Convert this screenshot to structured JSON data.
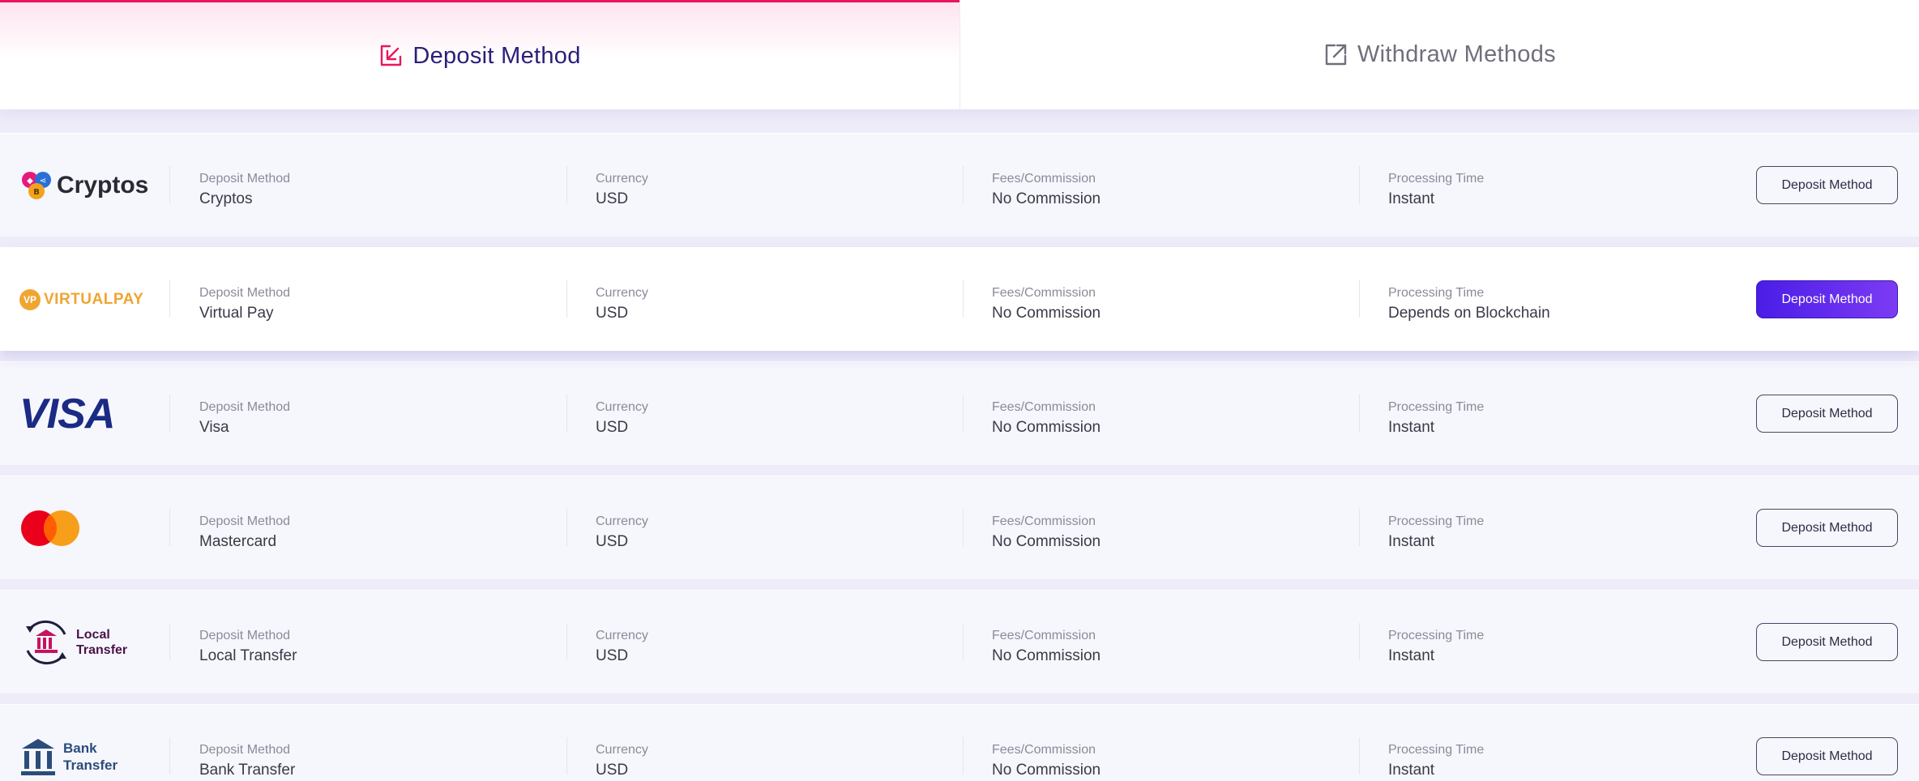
{
  "tabs": {
    "deposit": "Deposit Method",
    "withdraw": "Withdraw Methods"
  },
  "labels": {
    "method": "Deposit Method",
    "currency": "Currency",
    "fees": "Fees/Commission",
    "processing": "Processing Time",
    "button": "Deposit Method"
  },
  "colors": {
    "accent": "#e8175d",
    "title": "#2a1f7a",
    "button_primary": "#5a23ec"
  },
  "methods": [
    {
      "logo_text": "Cryptos",
      "method": "Cryptos",
      "currency": "USD",
      "fees": "No Commission",
      "processing": "Instant"
    },
    {
      "logo_text": "VIRTUALPAY",
      "logo_badge": "VP",
      "method": "Virtual Pay",
      "currency": "USD",
      "fees": "No Commission",
      "processing": "Depends on Blockchain"
    },
    {
      "logo_text": "VISA",
      "method": "Visa",
      "currency": "USD",
      "fees": "No Commission",
      "processing": "Instant"
    },
    {
      "method": "Mastercard",
      "currency": "USD",
      "fees": "No Commission",
      "processing": "Instant"
    },
    {
      "logo_text_1": "Local",
      "logo_text_2": "Transfer",
      "method": "Local Transfer",
      "currency": "USD",
      "fees": "No Commission",
      "processing": "Instant"
    },
    {
      "logo_text_1": "Bank",
      "logo_text_2": "Transfer",
      "method": "Bank Transfer",
      "currency": "USD",
      "fees": "No Commission",
      "processing": "Instant"
    }
  ]
}
